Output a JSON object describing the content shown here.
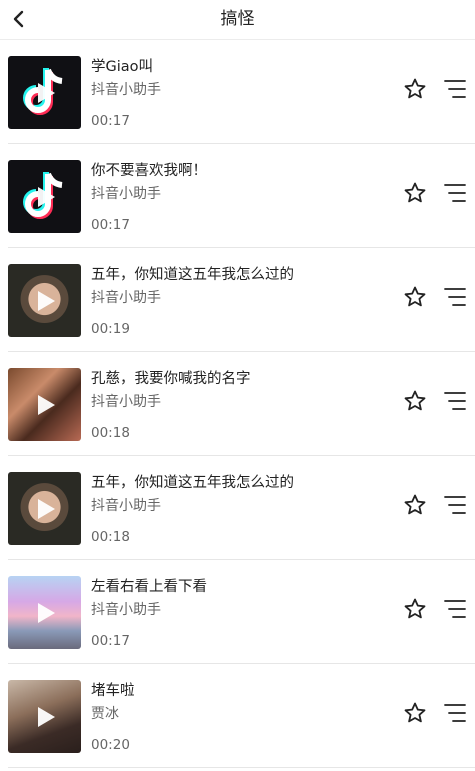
{
  "header": {
    "title": "搞怪"
  },
  "items": [
    {
      "title": "学Giao叫",
      "artist": "抖音小助手",
      "duration": "00:17",
      "thumb": "tiktok"
    },
    {
      "title": "你不要喜欢我啊！",
      "artist": "抖音小助手",
      "duration": "00:17",
      "thumb": "tiktok"
    },
    {
      "title": "五年，你知道这五年我怎么过的",
      "artist": "抖音小助手",
      "duration": "00:19",
      "thumb": "face"
    },
    {
      "title": "孔慈，我要你喊我的名字",
      "artist": "抖音小助手",
      "duration": "00:18",
      "thumb": "drama"
    },
    {
      "title": "五年，你知道这五年我怎么过的",
      "artist": "抖音小助手",
      "duration": "00:18",
      "thumb": "face"
    },
    {
      "title": "左看右看上看下看",
      "artist": "抖音小助手",
      "duration": "00:17",
      "thumb": "sky"
    },
    {
      "title": "堵车啦",
      "artist": "贾冰",
      "duration": "00:20",
      "thumb": "man"
    }
  ],
  "icons": {
    "back": "chevron-left-icon",
    "play": "play-icon",
    "favorite": "star-outline-icon",
    "menu": "playlist-menu-icon"
  },
  "colors": {
    "text": "#222222",
    "secondary": "#666666",
    "divider": "#e6e6e6"
  }
}
